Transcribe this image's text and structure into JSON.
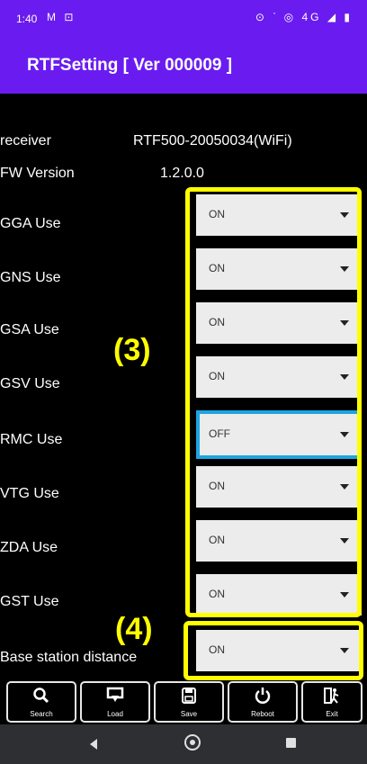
{
  "statusbar": {
    "time": "1:40",
    "left_icons": [
      "M",
      "⊡"
    ],
    "right_icons": "⊙ ᐝ ◎ 4G ◢ ▮"
  },
  "appbar": {
    "title": "RTFSetting  [ Ver 000009 ]"
  },
  "info": {
    "receiver_label": "receiver",
    "receiver_value": "RTF500-20050034(WiFi)",
    "fw_label": "FW Version",
    "fw_value": "1.2.0.0"
  },
  "settings": [
    {
      "label": "GGA Use",
      "value": "ON"
    },
    {
      "label": "GNS Use",
      "value": "ON"
    },
    {
      "label": "GSA Use",
      "value": "ON"
    },
    {
      "label": "GSV Use",
      "value": "ON"
    },
    {
      "label": "RMC Use",
      "value": "OFF"
    },
    {
      "label": "VTG Use",
      "value": "ON"
    },
    {
      "label": "ZDA Use",
      "value": "ON"
    },
    {
      "label": "GST Use",
      "value": "ON"
    },
    {
      "label": "Base station distance",
      "value": "ON"
    }
  ],
  "annotations": {
    "a3": "(3)",
    "a4": "(4)"
  },
  "colors": {
    "accent": "#6a1cf0",
    "highlight": "#ffff00",
    "focus": "#1fa4e0"
  },
  "toolbar": [
    {
      "label": "Search",
      "icon": "search-icon"
    },
    {
      "label": "Load",
      "icon": "load-icon"
    },
    {
      "label": "Save",
      "icon": "save-icon"
    },
    {
      "label": "Reboot",
      "icon": "power-icon"
    },
    {
      "label": "Exit",
      "icon": "exit-icon"
    }
  ]
}
